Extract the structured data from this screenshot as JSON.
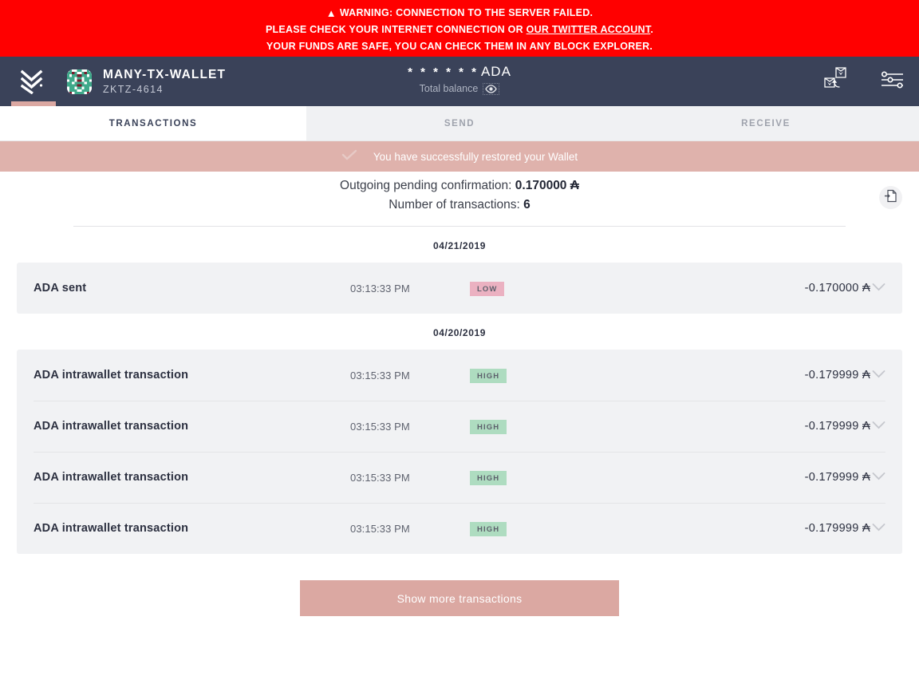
{
  "colors": {
    "warning_bg": "#ff0000",
    "header_bg": "#3a4259",
    "accent_salmon": "#dba8a2",
    "notify_bg": "#dfb2ac",
    "row_bg": "#f1f2f4",
    "badge_low_bg": "#ebb1c1",
    "badge_high_bg": "#aedcc0"
  },
  "warning": {
    "icon": "warning-triangle-icon",
    "line1": "WARNING: CONNECTION TO THE SERVER FAILED.",
    "line2_before": "PLEASE CHECK YOUR INTERNET CONNECTION OR ",
    "line2_link": "OUR TWITTER ACCOUNT",
    "line2_after": ".",
    "line3": "YOUR FUNDS ARE SAFE, YOU CAN CHECK THEM IN ANY BLOCK EXPLORER."
  },
  "header": {
    "logo": "daedalus-logo-icon",
    "avatar": "wallet-identicon",
    "wallet_name": "MANY-TX-WALLET",
    "wallet_id": "ZKTZ-4614",
    "balance_value": "* * * * * *",
    "balance_unit": "ADA",
    "balance_label": "Total balance",
    "eye_icon": "eye-icon",
    "wallet_switch_icon": "wallet-switch-icon",
    "settings_icon": "sliders-icon"
  },
  "tabs": [
    {
      "label": "TRANSACTIONS",
      "active": true
    },
    {
      "label": "SEND",
      "active": false
    },
    {
      "label": "RECEIVE",
      "active": false
    }
  ],
  "notification": {
    "icon": "check-icon",
    "text": "You have successfully restored your Wallet"
  },
  "summary": {
    "pending_label": "Outgoing pending confirmation:",
    "pending_value": "0.170000",
    "pending_unit": "₳",
    "count_label": "Number of transactions:",
    "count_value": "6",
    "export_icon": "export-file-icon"
  },
  "groups": [
    {
      "date": "04/21/2019",
      "rows": [
        {
          "title": "ADA sent",
          "time": "03:13:33 PM",
          "badge": "LOW",
          "badge_level": "low",
          "amount": "-0.170000",
          "unit": "₳",
          "chevron": "chevron-down-icon"
        }
      ]
    },
    {
      "date": "04/20/2019",
      "rows": [
        {
          "title": "ADA intrawallet transaction",
          "time": "03:15:33 PM",
          "badge": "HIGH",
          "badge_level": "high",
          "amount": "-0.179999",
          "unit": "₳",
          "chevron": "chevron-down-icon"
        },
        {
          "title": "ADA intrawallet transaction",
          "time": "03:15:33 PM",
          "badge": "HIGH",
          "badge_level": "high",
          "amount": "-0.179999",
          "unit": "₳",
          "chevron": "chevron-down-icon"
        },
        {
          "title": "ADA intrawallet transaction",
          "time": "03:15:33 PM",
          "badge": "HIGH",
          "badge_level": "high",
          "amount": "-0.179999",
          "unit": "₳",
          "chevron": "chevron-down-icon"
        },
        {
          "title": "ADA intrawallet transaction",
          "time": "03:15:33 PM",
          "badge": "HIGH",
          "badge_level": "high",
          "amount": "-0.179999",
          "unit": "₳",
          "chevron": "chevron-down-icon"
        }
      ]
    }
  ],
  "show_more_label": "Show more transactions"
}
